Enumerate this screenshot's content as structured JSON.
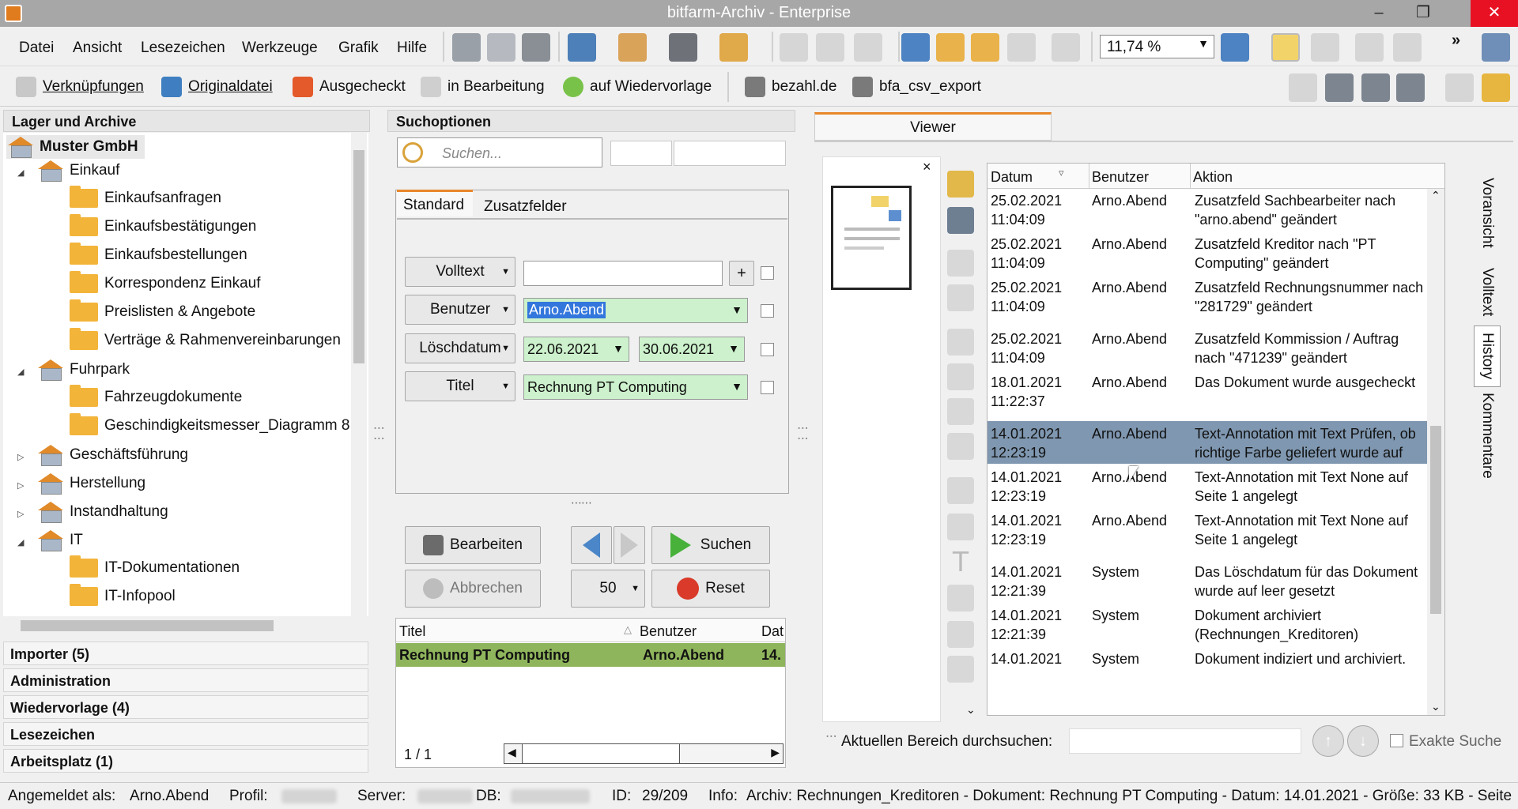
{
  "window": {
    "title": "bitfarm-Archiv - Enterprise",
    "minimize": "–",
    "maximize": "❐",
    "close": "✕"
  },
  "menu": [
    "Datei",
    "Ansicht",
    "Lesezeichen",
    "Werkzeuge",
    "Grafik",
    "Hilfe"
  ],
  "zoom": {
    "value": "11,74 %"
  },
  "overflow": "»",
  "toolbar2": {
    "links": "Verknüpfungen",
    "original": "Originaldatei",
    "checkedout": "Ausgecheckt",
    "inprogress": "in Bearbeitung",
    "resubmission": "auf Wiedervorlage",
    "bezahl": "bezahl.de",
    "csv": "bfa_csv_export"
  },
  "left": {
    "header": "Lager und Archive",
    "root": "Muster GmbH",
    "nodes": [
      "Einkauf",
      "Einkaufsanfragen",
      "Einkaufsbestätigungen",
      "Einkaufsbestellungen",
      "Korrespondenz Einkauf",
      "Preislisten & Angebote",
      "Verträge & Rahmenvereinbarungen",
      "Fuhrpark",
      "Fahrzeugdokumente",
      "Geschindigkeitsmesser_Diagramm 8",
      "Geschäftsführung",
      "Herstellung",
      "Instandhaltung",
      "IT",
      "IT-Dokumentationen",
      "IT-Infopool"
    ],
    "sections": [
      "Importer (5)",
      "Administration",
      "Wiedervorlage (4)",
      "Lesezeichen",
      "Arbeitsplatz (1)"
    ]
  },
  "search": {
    "header": "Suchoptionen",
    "placeholder": "Suchen...",
    "tab_standard": "Standard",
    "tab_extra": "Zusatzfelder",
    "fields": {
      "volltext": "Volltext",
      "benutzer": "Benutzer",
      "loeschdatum": "Löschdatum",
      "titel": "Titel"
    },
    "values": {
      "benutzer": "Arno.Abend",
      "date_from": "22.06.2021",
      "date_to": "30.06.2021",
      "titel": "Rechnung PT Computing"
    },
    "plus": "+",
    "buttons": {
      "edit": "Bearbeiten",
      "cancel": "Abbrechen",
      "search": "Suchen",
      "reset": "Reset",
      "pagesize": "50"
    },
    "results": {
      "col_title": "Titel",
      "col_user": "Benutzer",
      "col_date": "Dat",
      "row": {
        "title": "Rechnung PT Computing",
        "user": "Arno.Abend",
        "date": "14."
      }
    },
    "pager": "1 / 1"
  },
  "viewer": {
    "tab": "Viewer",
    "close": "×",
    "columns": {
      "date": "Datum",
      "user": "Benutzer",
      "action": "Aktion"
    },
    "rows": [
      {
        "d": "25.02.2021",
        "t": "11:04:09",
        "u": "Arno.Abend",
        "a1": "Zusatzfeld Sachbearbeiter nach",
        "a2": "\"arno.abend\" geändert"
      },
      {
        "d": "25.02.2021",
        "t": "11:04:09",
        "u": "Arno.Abend",
        "a1": "Zusatzfeld Kreditor nach \"PT",
        "a2": "Computing\" geändert"
      },
      {
        "d": "25.02.2021",
        "t": "11:04:09",
        "u": "Arno.Abend",
        "a1": "Zusatzfeld Rechnungsnummer nach",
        "a2": "\"281729\" geändert"
      },
      {
        "d": "25.02.2021",
        "t": "11:04:09",
        "u": "Arno.Abend",
        "a1": "Zusatzfeld Kommission / Auftrag",
        "a2": "nach \"471239\" geändert"
      },
      {
        "d": "18.01.2021",
        "t": "11:22:37",
        "u": "Arno.Abend",
        "a1": "Das Dokument wurde ausgecheckt",
        "a2": ""
      },
      {
        "d": "14.01.2021",
        "t": "12:23:19",
        "u": "Arno.Abend",
        "a1": "Text-Annotation mit Text Prüfen, ob",
        "a2": "richtige Farbe geliefert wurde auf"
      },
      {
        "d": "14.01.2021",
        "t": "12:23:19",
        "u": "Arno.Abend",
        "a1": "Text-Annotation mit Text None auf",
        "a2": "Seite 1 angelegt"
      },
      {
        "d": "14.01.2021",
        "t": "12:23:19",
        "u": "Arno.Abend",
        "a1": "Text-Annotation mit Text None auf",
        "a2": "Seite 1 angelegt"
      },
      {
        "d": "14.01.2021",
        "t": "12:21:39",
        "u": "System",
        "a1": "Das Löschdatum für das Dokument",
        "a2": "wurde auf leer gesetzt"
      },
      {
        "d": "14.01.2021",
        "t": "12:21:39",
        "u": "System",
        "a1": "Dokument archiviert",
        "a2": "(Rechnungen_Kreditoren)"
      },
      {
        "d": "14.01.2021",
        "t": "",
        "u": "System",
        "a1": "Dokument indiziert und archiviert.",
        "a2": ""
      }
    ],
    "side_tabs": [
      "Voransicht",
      "Volltext",
      "History",
      "Kommentare"
    ],
    "area_search_label": "Aktuellen Bereich durchsuchen:",
    "exact": "Exakte Suche"
  },
  "status": {
    "logged_as_label": "Angemeldet als:",
    "logged_as": "Arno.Abend",
    "profile_label": "Profil:",
    "server_label": "Server:",
    "db_label": "DB:",
    "id_label": "ID:",
    "id": "29/209",
    "info_label": "Info:",
    "info": "Archiv: Rechnungen_Kreditoren - Dokument: Rechnung PT Computing - Datum: 14.01.2021 - Größe: 33 KB - Seite"
  }
}
